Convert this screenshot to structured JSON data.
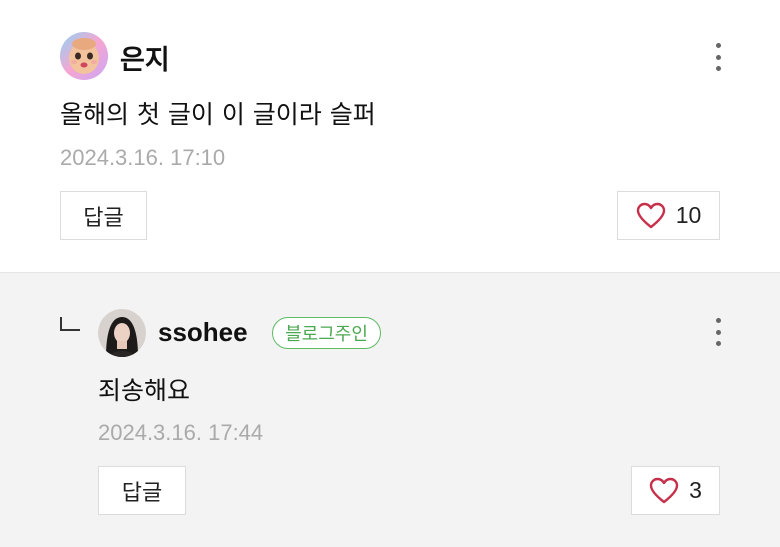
{
  "comments": [
    {
      "author": "은지",
      "text": "올해의 첫 글이 이 글이라 슬퍼",
      "timestamp": "2024.3.16. 17:10",
      "reply_label": "답글",
      "likes": "10",
      "avatar_icon": "cartoon-baby-avatar",
      "more_icon": "more-vertical-icon",
      "like_icon": "heart-outline-icon"
    },
    {
      "author": "ssohee",
      "badge": "블로그주인",
      "text": "죄송해요",
      "timestamp": "2024.3.16. 17:44",
      "reply_label": "답글",
      "likes": "3",
      "avatar_icon": "profile-photo-avatar",
      "more_icon": "more-vertical-icon",
      "like_icon": "heart-outline-icon",
      "reply_indicator_icon": "reply-arrow-icon"
    }
  ],
  "colors": {
    "badge_green": "#4aa851",
    "heart_red": "#c7304b",
    "timestamp_gray": "#aaaaaa",
    "reply_background": "#f3f3f3"
  }
}
